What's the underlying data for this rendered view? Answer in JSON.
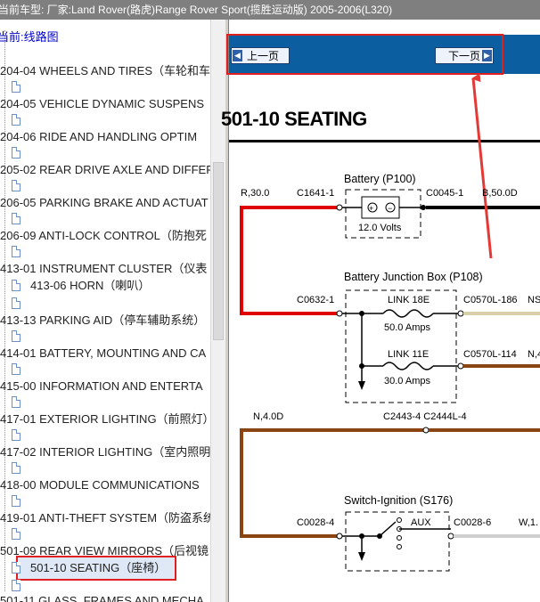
{
  "window": {
    "title_bar": "当前车型:  厂家:Land Rover(路虎)Range Rover Sport(揽胜运动版) 2005-2006(L320)"
  },
  "tree": {
    "root": "当前:线路图",
    "items": [
      {
        "label": "204-04 WHEELS AND TIRES（车轮和车"
      },
      {
        "label": "204-05 VEHICLE DYNAMIC SUSPENS"
      },
      {
        "label": "204-06 RIDE AND HANDLING OPTIM"
      },
      {
        "label": "205-02 REAR DRIVE AXLE AND DIFFER"
      },
      {
        "label": "206-05 PARKING BRAKE AND ACTUAT"
      },
      {
        "label": "206-09 ANTI-LOCK CONTROL（防抱死"
      },
      {
        "label": "413-01 INSTRUMENT CLUSTER（仪表"
      },
      {
        "label": "413-06 HORN（喇叭）"
      },
      {
        "label": "413-13 PARKING AID（停车辅助系统）"
      },
      {
        "label": "414-01 BATTERY, MOUNTING AND CA"
      },
      {
        "label": "415-00 INFORMATION AND ENTERTA"
      },
      {
        "label": "417-01 EXTERIOR LIGHTING（前照灯）"
      },
      {
        "label": "417-02 INTERIOR LIGHTING（室内照明"
      },
      {
        "label": "418-00 MODULE COMMUNICATIONS"
      },
      {
        "label": "419-01 ANTI-THEFT SYSTEM（防盗系统"
      },
      {
        "label": "501-09 REAR VIEW MIRRORS（后视镜"
      },
      {
        "label": "501-10 SEATING（座椅）"
      },
      {
        "label": "501-11 GLASS, FRAMES AND MECHA"
      }
    ]
  },
  "nav": {
    "prev": "上一页",
    "next": "下一页"
  },
  "diagram": {
    "title": "501-10 SEATING",
    "battery": {
      "name": "Battery (P100)",
      "volts": "12.0 Volts"
    },
    "bjb": {
      "name": "Battery Junction Box (P108)",
      "link1": "LINK 18E",
      "amps1": "50.0 Amps",
      "link2": "LINK 11E",
      "amps2": "30.0 Amps"
    },
    "switch": {
      "name": "Switch-Ignition (S176)",
      "aux": "AUX"
    },
    "wires": {
      "w1": "R,30.0",
      "c1": "C1641-1",
      "c2": "C0045-1",
      "w2": "B,50.0D",
      "c3": "C0632-1",
      "c4": "C0570L-186",
      "w3": "NS",
      "c5": "C0570L-114",
      "w4": "N,4",
      "w5": "N,4.0D",
      "c6": "C2443-4 C2444L-4",
      "c7": "C0028-4",
      "c8": "C0028-6",
      "w6": "W,1."
    }
  }
}
